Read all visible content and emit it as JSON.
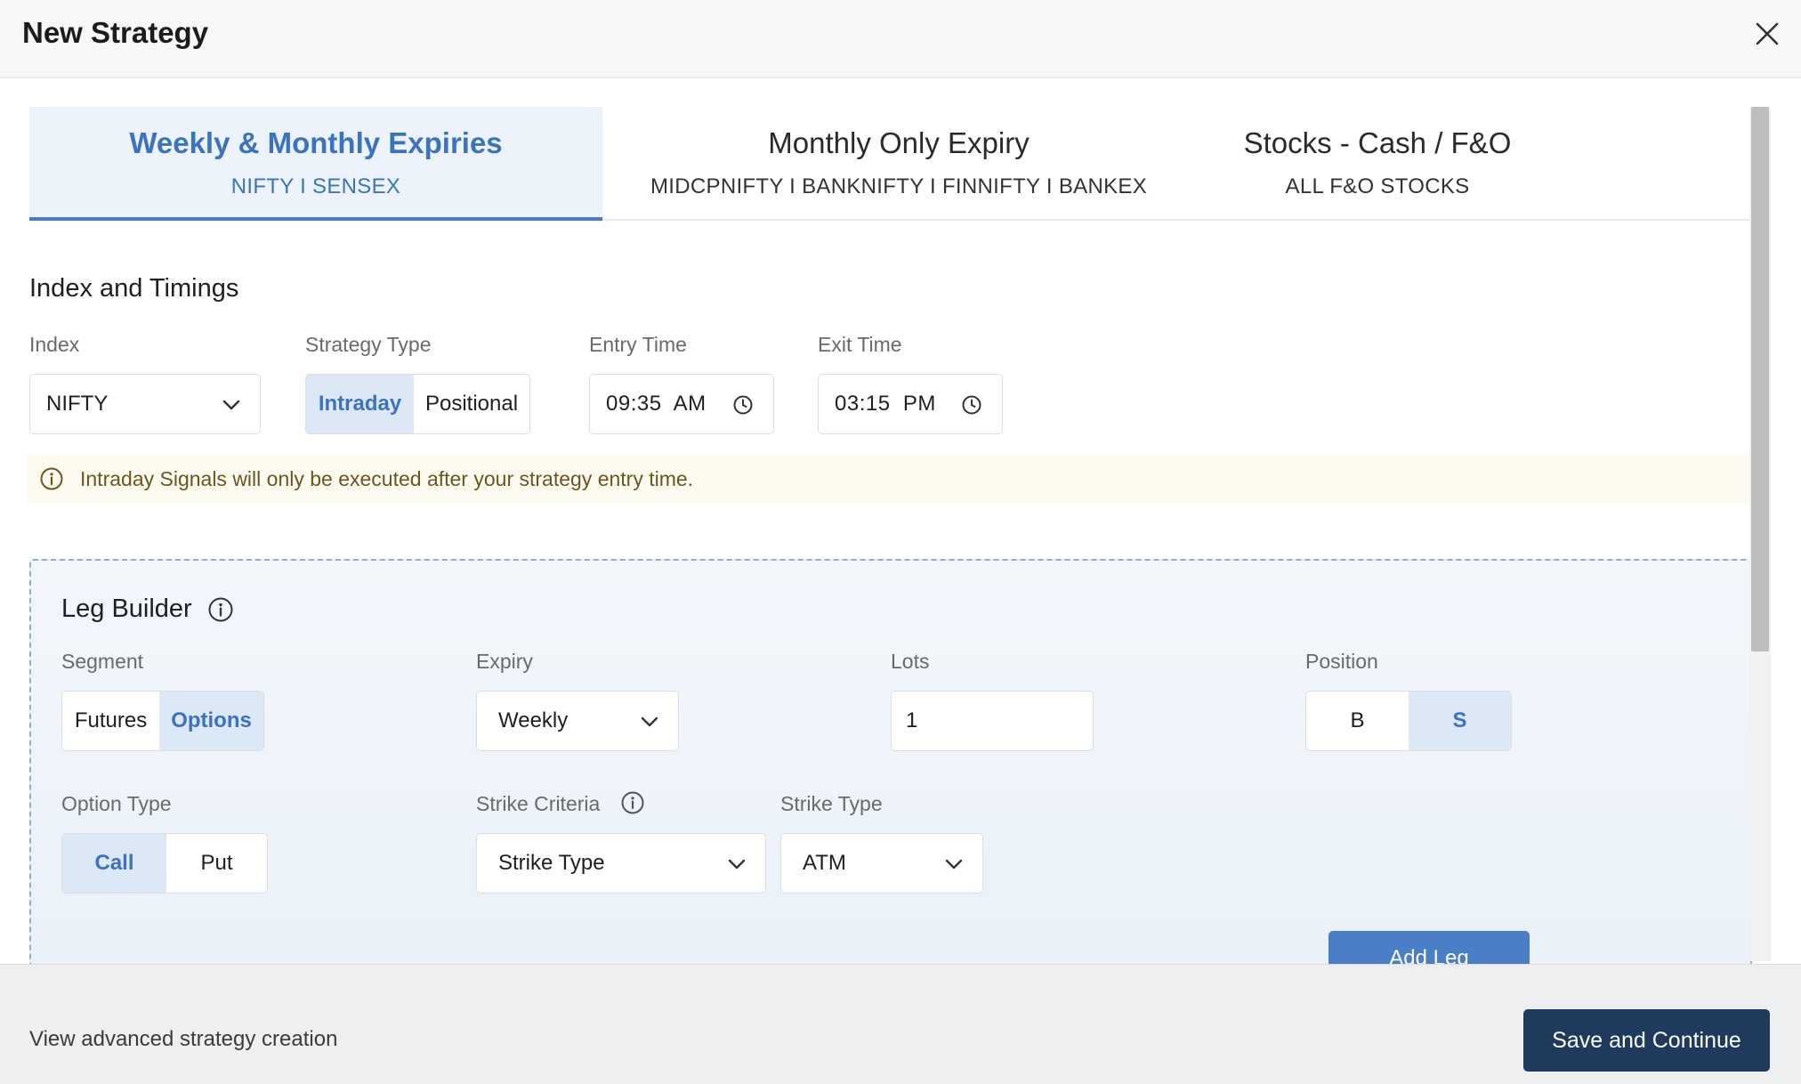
{
  "modal": {
    "title": "New Strategy",
    "close_icon": "close-icon"
  },
  "tabs": [
    {
      "title": "Weekly & Monthly Expiries",
      "subtitle": "NIFTY I SENSEX",
      "active": true
    },
    {
      "title": "Monthly Only Expiry",
      "subtitle": "MIDCPNIFTY I BANKNIFTY I FINNIFTY I BANKEX",
      "active": false
    },
    {
      "title": "Stocks - Cash / F&O",
      "subtitle": "ALL F&O STOCKS",
      "active": false
    }
  ],
  "index_timings": {
    "section_title": "Index and Timings",
    "index": {
      "label": "Index",
      "value": "NIFTY"
    },
    "strategy_type": {
      "label": "Strategy Type",
      "options": [
        "Intraday",
        "Positional"
      ],
      "selected": "Intraday"
    },
    "entry_time": {
      "label": "Entry Time",
      "value": "09:35  AM"
    },
    "exit_time": {
      "label": "Exit Time",
      "value": "03:15  PM"
    },
    "info_banner": "Intraday Signals will only be executed after your strategy entry time."
  },
  "leg_builder": {
    "title": "Leg Builder",
    "segment": {
      "label": "Segment",
      "options": [
        "Futures",
        "Options"
      ],
      "selected": "Options"
    },
    "expiry": {
      "label": "Expiry",
      "value": "Weekly"
    },
    "lots": {
      "label": "Lots",
      "value": "1"
    },
    "position": {
      "label": "Position",
      "options": [
        "B",
        "S"
      ],
      "selected": "S"
    },
    "option_type": {
      "label": "Option Type",
      "options": [
        "Call",
        "Put"
      ],
      "selected": "Call"
    },
    "strike_criteria": {
      "label": "Strike Criteria",
      "value": "Strike Type"
    },
    "strike_type": {
      "label": "Strike Type",
      "value": "ATM"
    },
    "add_leg_label": "Add Leg"
  },
  "footer": {
    "advanced_link": "View advanced strategy creation",
    "save_label": "Save and Continue"
  },
  "colors": {
    "accent": "#3c73c0",
    "active_bg": "#dce8f6",
    "primary_button": "#1f3a5c",
    "add_leg_button": "#4a7ec7",
    "banner_bg": "#fdfbf0"
  }
}
